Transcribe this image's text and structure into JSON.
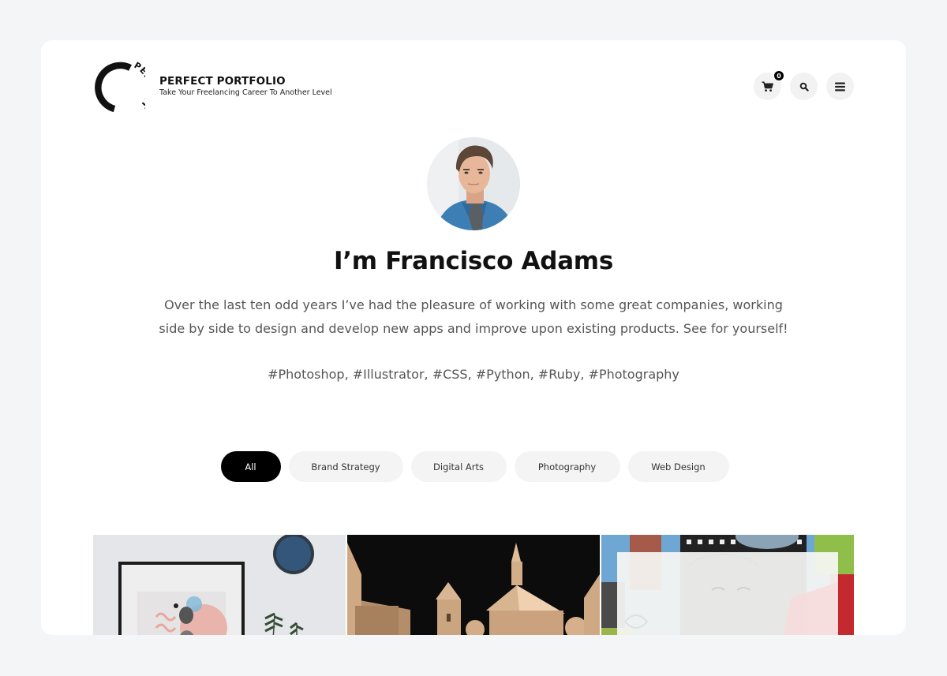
{
  "header": {
    "logo_text": "PERFECT",
    "brand_title": "PERFECT PORTFOLIO",
    "brand_tagline": "Take Your Freelancing Career To Another Level",
    "actions": [
      {
        "name": "cart",
        "icon": "shopping-cart-icon",
        "badge": "0"
      },
      {
        "name": "search",
        "icon": "search-icon"
      },
      {
        "name": "menu",
        "icon": "hamburger-menu-icon"
      }
    ]
  },
  "hero": {
    "avatar_alt": "Portrait of Francisco Adams",
    "title": "I’m Francisco Adams",
    "description": "Over the last ten odd years I’ve had the pleasure of working with some great companies, working side by side to design and develop new apps and improve upon existing products. See for yourself!",
    "tags": "#Photoshop, #Illustrator, #CSS, #Python, #Ruby, #Photography",
    "highlight_color": "#d4f8ec"
  },
  "filters": [
    {
      "label": "All",
      "active": true
    },
    {
      "label": "Brand Strategy",
      "active": false
    },
    {
      "label": "Digital Arts",
      "active": false
    },
    {
      "label": "Photography",
      "active": false
    },
    {
      "label": "Web Design",
      "active": false
    }
  ],
  "gallery": [
    {
      "alt": "Framed art print on wall with mirror and plant"
    },
    {
      "alt": "Wooden architectural model of domed buildings"
    },
    {
      "alt": "Colorful illustrated street mural with faces"
    }
  ]
}
